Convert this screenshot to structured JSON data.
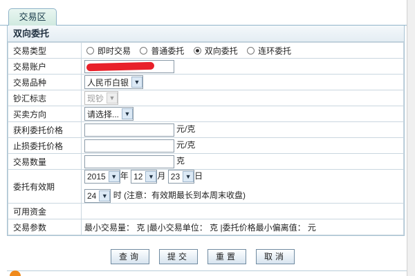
{
  "tab": {
    "label": "交易区"
  },
  "panel": {
    "title": "双向委托"
  },
  "trade_type": {
    "label": "交易类型",
    "options": [
      "即时交易",
      "普通委托",
      "双向委托",
      "连环委托"
    ],
    "selected_index": 2
  },
  "account": {
    "label": "交易账户"
  },
  "product": {
    "label": "交易品种",
    "value": "人民币白银"
  },
  "cash_flag": {
    "label": "钞汇标志",
    "value": "现钞"
  },
  "direction": {
    "label": "买卖方向",
    "value": "请选择..."
  },
  "take_profit": {
    "label": "获利委托价格",
    "unit": "元/克"
  },
  "stop_loss": {
    "label": "止损委托价格",
    "unit": "元/克"
  },
  "quantity": {
    "label": "交易数量",
    "unit": "克"
  },
  "validity": {
    "label": "委托有效期",
    "year": "2015",
    "year_unit": "年",
    "month": "12",
    "month_unit": "月",
    "day": "23",
    "day_unit": "日",
    "hour": "24",
    "hour_unit": "时",
    "note": "(注意：有效期最长到本周末收盘)"
  },
  "funds": {
    "label": "可用资金"
  },
  "params": {
    "label": "交易参数",
    "text": "最小交易量： 克 |最小交易单位： 克 |委托价格最小偏离值： 元"
  },
  "buttons": {
    "query": "查询",
    "submit": "提交",
    "reset": "重置",
    "cancel": "取消"
  },
  "colors": {
    "redaction": "#e8202a",
    "border": "#a9c3d3"
  }
}
